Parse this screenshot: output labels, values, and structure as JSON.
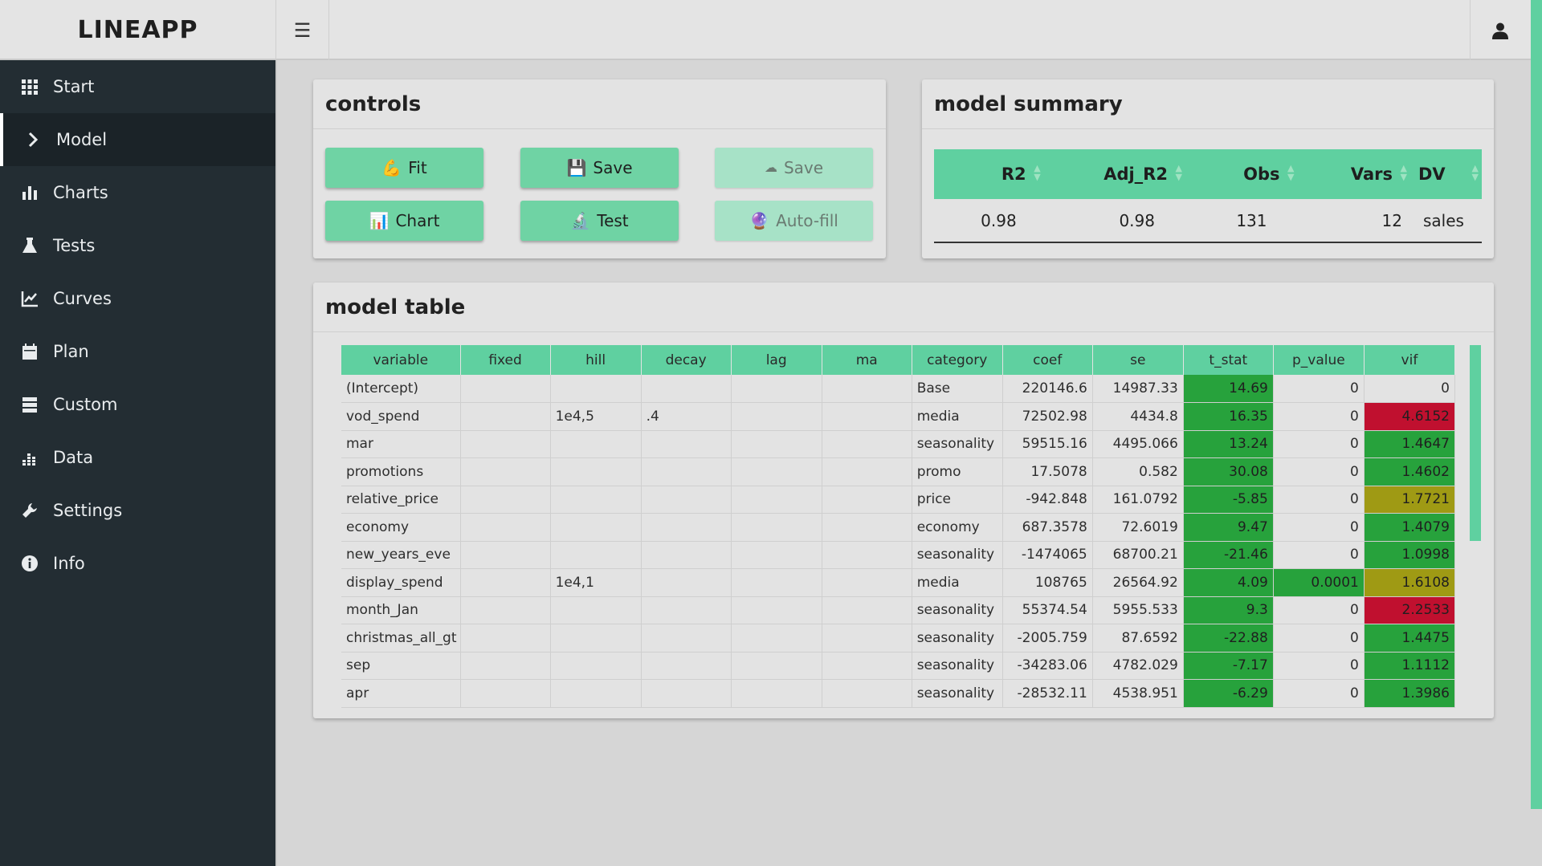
{
  "app": {
    "logo": "LINEAPP"
  },
  "header": {
    "menu_icon": "hamburger-icon",
    "user_icon": "user-icon"
  },
  "sidebar": {
    "items": [
      {
        "label": "Start",
        "icon": "grid-icon"
      },
      {
        "label": "Model",
        "icon": "chevron-right-icon",
        "active": true
      },
      {
        "label": "Charts",
        "icon": "bar-chart-icon"
      },
      {
        "label": "Tests",
        "icon": "flask-icon"
      },
      {
        "label": "Curves",
        "icon": "line-chart-icon"
      },
      {
        "label": "Plan",
        "icon": "calendar-icon"
      },
      {
        "label": "Custom",
        "icon": "server-icon"
      },
      {
        "label": "Data",
        "icon": "data-icon"
      },
      {
        "label": "Settings",
        "icon": "wrench-icon"
      },
      {
        "label": "Info",
        "icon": "info-icon"
      }
    ]
  },
  "controls": {
    "title": "controls",
    "buttons": {
      "fit": {
        "label": "Fit",
        "icon": "flexed-biceps-icon"
      },
      "save": {
        "label": "Save",
        "icon": "floppy-disk-icon"
      },
      "cloud_save": {
        "label": "Save",
        "icon": "cloud-icon",
        "disabled": true
      },
      "chart": {
        "label": "Chart",
        "icon": "bar-chart-icon"
      },
      "test": {
        "label": "Test",
        "icon": "microscope-icon"
      },
      "autofill": {
        "label": "Auto-fill",
        "icon": "crystal-ball-icon",
        "disabled": true
      }
    }
  },
  "summary": {
    "title": "model summary",
    "headers": [
      "R2",
      "Adj_R2",
      "Obs",
      "Vars",
      "DV"
    ],
    "row": [
      "0.98",
      "0.98",
      "131",
      "12",
      "sales"
    ]
  },
  "model_table": {
    "title": "model table",
    "headers": [
      "variable",
      "fixed",
      "hill",
      "decay",
      "lag",
      "ma",
      "category",
      "coef",
      "se",
      "t_stat",
      "p_value",
      "vif"
    ],
    "rows": [
      [
        "(Intercept)",
        "",
        "",
        "",
        "",
        "",
        "Base",
        "220146.6",
        "14987.33",
        "14.69",
        "0",
        "0"
      ],
      [
        "vod_spend",
        "",
        "1e4,5",
        ".4",
        "",
        "",
        "media",
        "72502.98",
        "4434.8",
        "16.35",
        "0",
        "4.6152"
      ],
      [
        "mar",
        "",
        "",
        "",
        "",
        "",
        "seasonality",
        "59515.16",
        "4495.066",
        "13.24",
        "0",
        "1.4647"
      ],
      [
        "promotions",
        "",
        "",
        "",
        "",
        "",
        "promo",
        "17.5078",
        "0.582",
        "30.08",
        "0",
        "1.4602"
      ],
      [
        "relative_price",
        "",
        "",
        "",
        "",
        "",
        "price",
        "-942.848",
        "161.0792",
        "-5.85",
        "0",
        "1.7721"
      ],
      [
        "economy",
        "",
        "",
        "",
        "",
        "",
        "economy",
        "687.3578",
        "72.6019",
        "9.47",
        "0",
        "1.4079"
      ],
      [
        "new_years_eve",
        "",
        "",
        "",
        "",
        "",
        "seasonality",
        "-1474065",
        "68700.21",
        "-21.46",
        "0",
        "1.0998"
      ],
      [
        "display_spend",
        "",
        "1e4,1",
        "",
        "",
        "",
        "media",
        "108765",
        "26564.92",
        "4.09",
        "0.0001",
        "1.6108"
      ],
      [
        "month_Jan",
        "",
        "",
        "",
        "",
        "",
        "seasonality",
        "55374.54",
        "5955.533",
        "9.3",
        "0",
        "2.2533"
      ],
      [
        "christmas_all_gt",
        "",
        "",
        "",
        "",
        "",
        "seasonality",
        "-2005.759",
        "87.6592",
        "-22.88",
        "0",
        "1.4475"
      ],
      [
        "sep",
        "",
        "",
        "",
        "",
        "",
        "seasonality",
        "-34283.06",
        "4782.029",
        "-7.17",
        "0",
        "1.1112"
      ],
      [
        "apr",
        "",
        "",
        "",
        "",
        "",
        "seasonality",
        "-28532.11",
        "4538.951",
        "-6.29",
        "0",
        "1.3986"
      ]
    ],
    "colors": {
      "green": "#27a23c",
      "olive": "#9f9a14",
      "red": "#c0102f"
    },
    "t_stat_colors": [
      "green",
      "green",
      "green",
      "green",
      "green",
      "green",
      "green",
      "green",
      "green",
      "green",
      "green",
      "green"
    ],
    "p_value_colors": [
      "",
      "",
      "",
      "",
      "",
      "",
      "",
      "green",
      "",
      "",
      "",
      ""
    ],
    "vif_colors": [
      "",
      "red",
      "green",
      "green",
      "olive",
      "green",
      "green",
      "olive",
      "red",
      "green",
      "green",
      "green"
    ]
  }
}
